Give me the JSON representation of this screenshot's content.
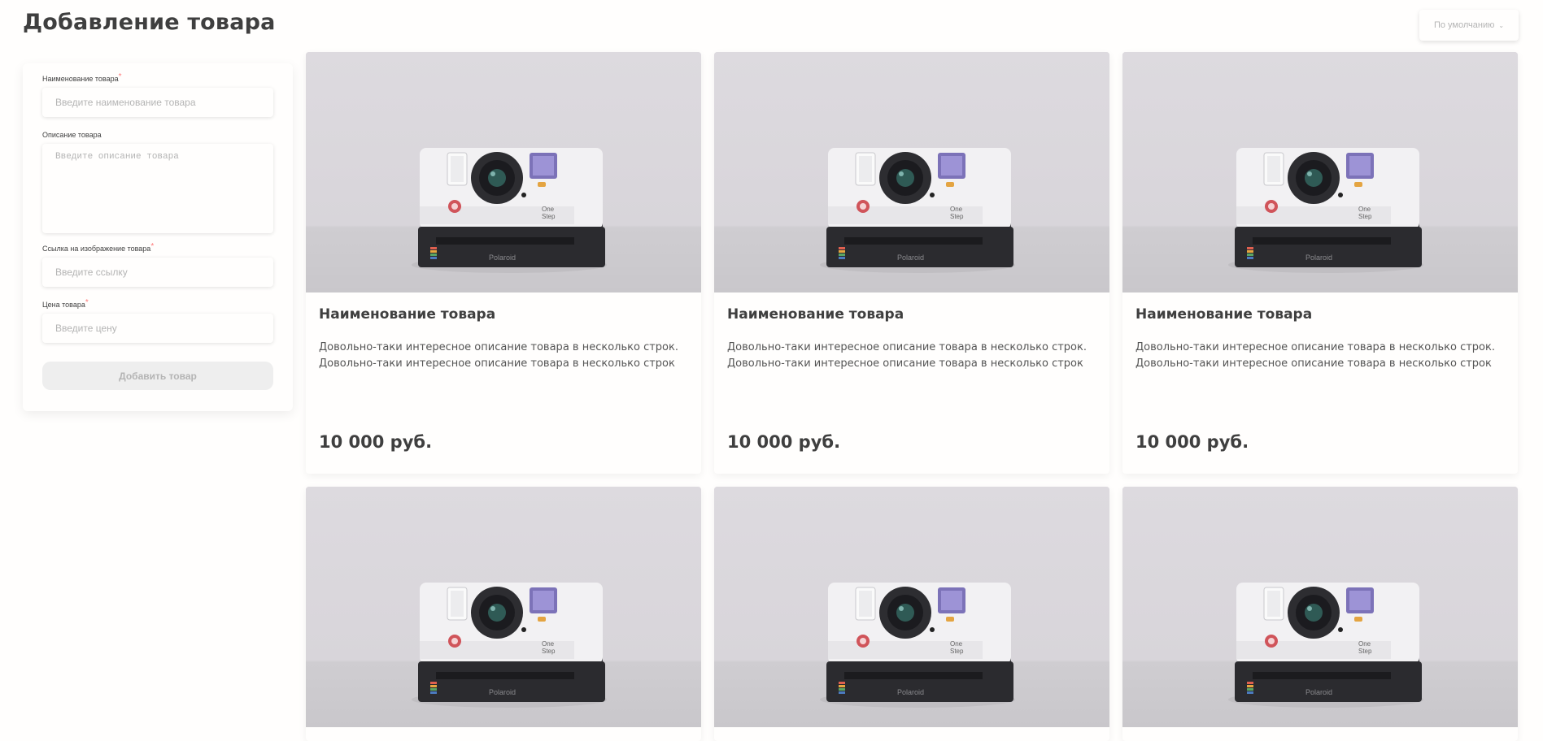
{
  "header": {
    "title": "Добавление товара",
    "sort_label": "По умолчанию",
    "sort_icon": "chevron-down-icon"
  },
  "form": {
    "name_label": "Наименование товара",
    "name_placeholder": "Введите наименование товара",
    "description_label": "Описание товара",
    "description_placeholder": "Введите описание товара",
    "image_label": "Ссылка на изображение товара",
    "image_placeholder": "Введите ссылку",
    "price_label": "Цена товара",
    "price_placeholder": "Введите цену",
    "required_mark": "*",
    "submit_label": "Добавить товар"
  },
  "products": [
    {
      "title": "Наименование товара",
      "description": "Довольно-таки интересное описание товара в несколько строк. Довольно-таки интересное описание товара в несколько строк",
      "price": "10 000 руб.",
      "image": "polaroid-camera-image"
    },
    {
      "title": "Наименование товара",
      "description": "Довольно-таки интересное описание товара в несколько строк. Довольно-таки интересное описание товара в несколько строк",
      "price": "10 000 руб.",
      "image": "polaroid-camera-image"
    },
    {
      "title": "Наименование товара",
      "description": "Довольно-таки интересное описание товара в несколько строк. Довольно-таки интересное описание товара в несколько строк",
      "price": "10 000 руб.",
      "image": "polaroid-camera-image"
    },
    {
      "title": "",
      "description": "",
      "price": "",
      "image": "polaroid-camera-image"
    },
    {
      "title": "",
      "description": "",
      "price": "",
      "image": "polaroid-camera-image"
    },
    {
      "title": "",
      "description": "",
      "price": "",
      "image": "polaroid-camera-image"
    }
  ],
  "colors": {
    "background": "#fffefd",
    "text": "#3f3f3f",
    "placeholder": "#b4b4b4",
    "required": "#ff7c7c",
    "button_disabled": "#eeeeee"
  }
}
